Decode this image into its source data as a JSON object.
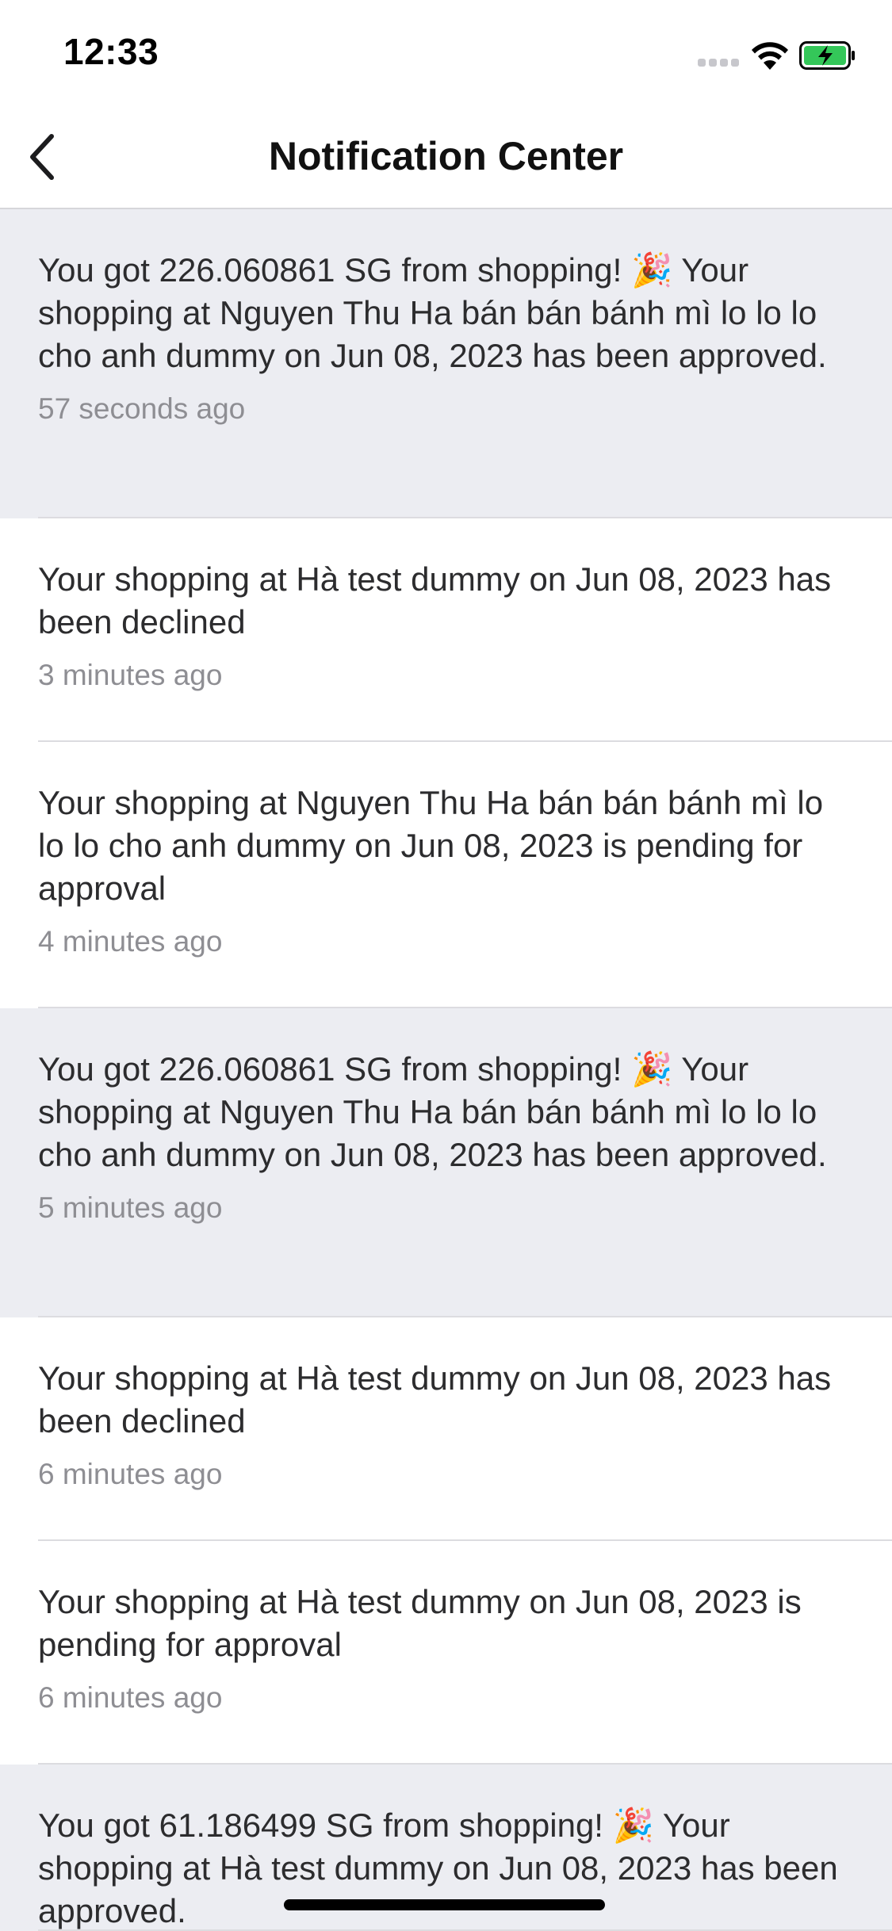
{
  "status_bar": {
    "time": "12:33"
  },
  "nav": {
    "title": "Notification Center"
  },
  "notifications": [
    {
      "text": "You got 226.060861 SG from shopping! 🎉 Your shopping at Nguyen Thu Ha bán bán bánh mì lo lo lo cho anh dummy on Jun 08, 2023 has been approved.",
      "time": "57 seconds ago",
      "unread": true
    },
    {
      "text": "Your shopping at Hà test dummy on Jun 08, 2023 has been declined",
      "time": "3 minutes ago",
      "unread": false
    },
    {
      "text": "Your shopping at Nguyen Thu Ha bán bán bánh mì lo lo lo cho anh dummy on Jun 08, 2023 is pending for approval",
      "time": "4 minutes ago",
      "unread": false
    },
    {
      "text": "You got 226.060861 SG from shopping! 🎉 Your shopping at Nguyen Thu Ha bán bán bánh mì lo lo lo cho anh dummy on Jun 08, 2023 has been approved.",
      "time": "5 minutes ago",
      "unread": true
    },
    {
      "text": "Your shopping at Hà test dummy on Jun 08, 2023 has been declined",
      "time": "6 minutes ago",
      "unread": false
    },
    {
      "text": "Your shopping at Hà test dummy on Jun 08, 2023 is pending for approval",
      "time": "6 minutes ago",
      "unread": false
    },
    {
      "text": "You got 61.186499 SG from shopping! 🎉 Your shopping at Hà test dummy on Jun 08, 2023 has been approved.",
      "time": "",
      "unread": true
    }
  ],
  "colors": {
    "unread_background": "#ecedf2",
    "read_background": "#ffffff",
    "timestamp": "#8e8e93",
    "battery_fill": "#34c759"
  },
  "icons": {
    "back": "chevron-left-icon",
    "wifi": "wifi-icon",
    "battery": "battery-charging-icon",
    "signal": "cellular-signal-icon"
  }
}
